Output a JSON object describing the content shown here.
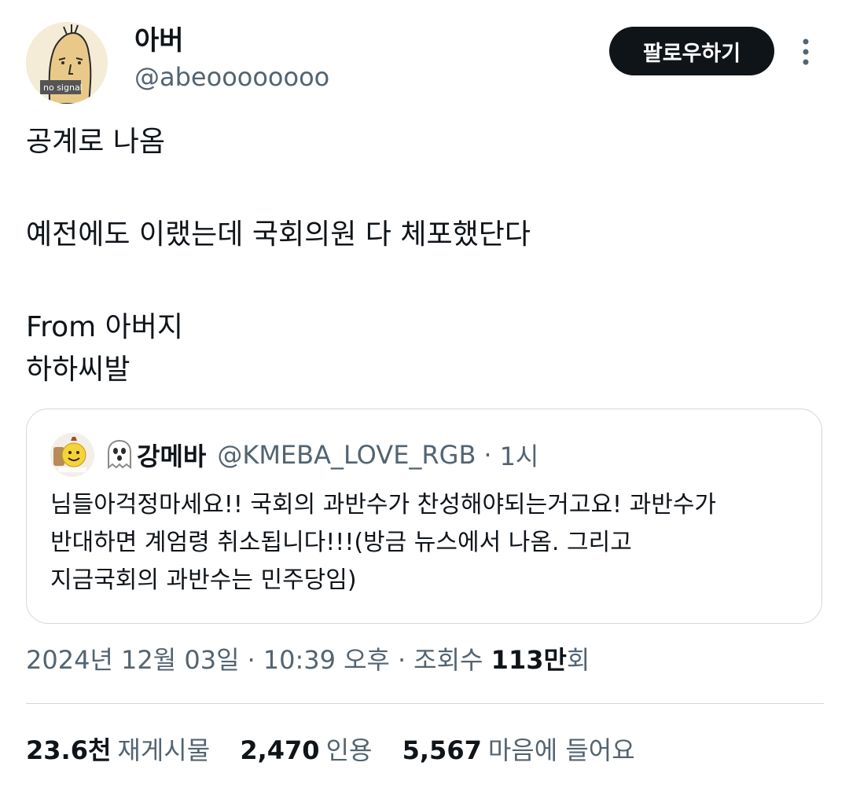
{
  "author": {
    "display_name": "아버",
    "handle": "@abeoooooooo",
    "avatar_icon": "no-signal-avatar",
    "avatar_caption": "no signal"
  },
  "follow_button": {
    "label": "팔로우하기"
  },
  "more_icon": "more-vertical-icon",
  "tweet": {
    "lines": [
      "공계로 나옴",
      "예전에도 이랬는데 국회의원 다 체포했단다",
      "From 아버지",
      "하하씨발"
    ]
  },
  "quoted_tweet": {
    "avatar_icon": "emoji-avatar",
    "badge_icon": "ghost-icon",
    "display_name": "강메바",
    "handle": "@KMEBA_LOVE_RGB",
    "separator": "·",
    "time": "1시",
    "lines": [
      "님들아걱정마세요!! 국회의 과반수가 찬성해야되는거고요! 과반수가",
      "반대하면 계엄령 취소됩니다!!!(방금 뉴스에서 나옴. 그리고",
      "지금국회의 과반수는 민주당임)"
    ]
  },
  "meta": {
    "date": "2024년 12월 03일",
    "separator": "·",
    "time": "10:39 오후",
    "views_label": "조회수",
    "views_number": "113만",
    "views_suffix": "회"
  },
  "stats": {
    "retweets": {
      "value": "23.6천",
      "label": "재게시물"
    },
    "quotes": {
      "value": "2,470",
      "label": "인용"
    },
    "likes": {
      "value": "5,567",
      "label": "마음에 들어요"
    }
  },
  "colors": {
    "primary_text": "#0f1419",
    "secondary_text": "#536471",
    "border": "#cfd9de",
    "button_bg": "#0f1419",
    "button_text": "#ffffff"
  }
}
